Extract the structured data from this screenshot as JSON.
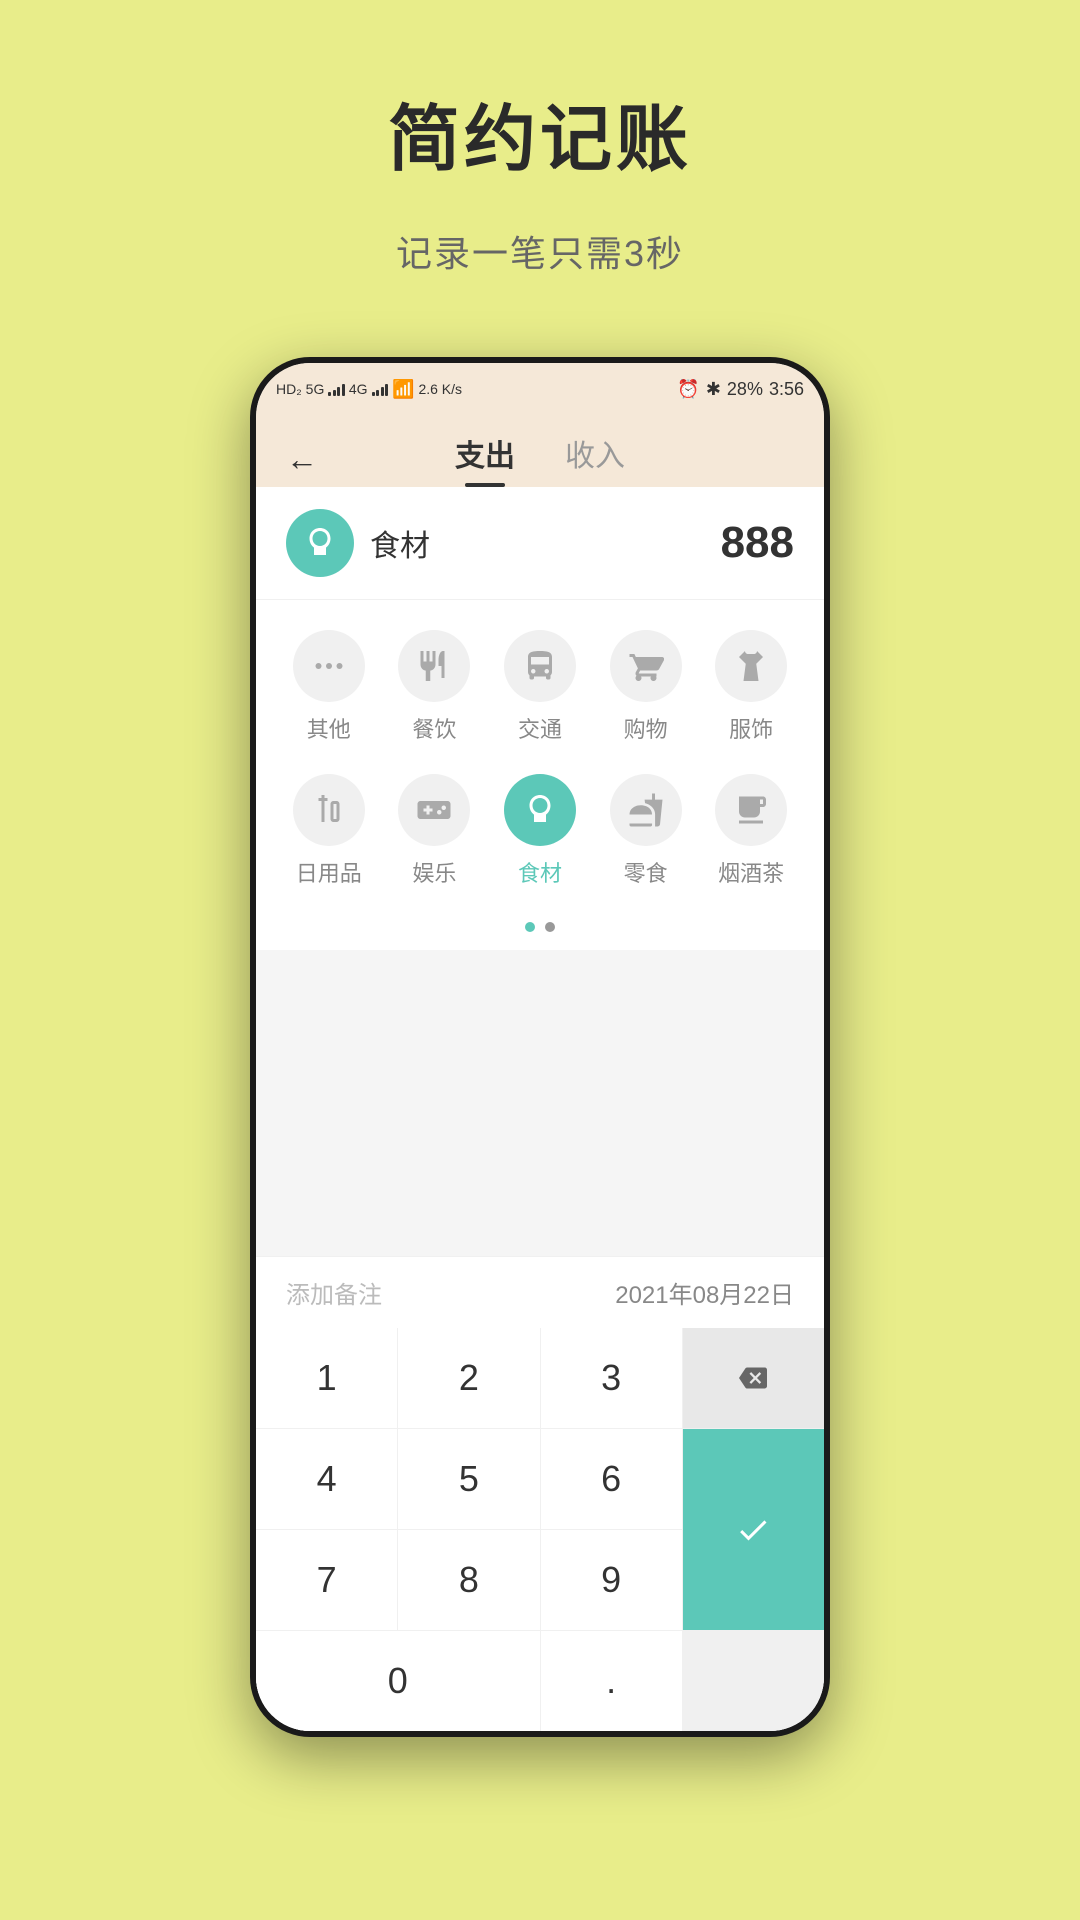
{
  "page": {
    "title": "简约记账",
    "subtitle": "记录一笔只需3秒"
  },
  "statusBar": {
    "leftText": "5G 4G",
    "speed": "2.6 K/s",
    "battery": "28%",
    "time": "3:56"
  },
  "header": {
    "backLabel": "←",
    "tabs": [
      {
        "label": "支出",
        "active": true
      },
      {
        "label": "收入",
        "active": false
      }
    ]
  },
  "selectedCategory": {
    "name": "食材",
    "amount": "888"
  },
  "categories": [
    {
      "id": "other",
      "label": "其他",
      "active": false
    },
    {
      "id": "food",
      "label": "餐饮",
      "active": false
    },
    {
      "id": "transport",
      "label": "交通",
      "active": false
    },
    {
      "id": "shopping",
      "label": "购物",
      "active": false
    },
    {
      "id": "clothing",
      "label": "服饰",
      "active": false
    },
    {
      "id": "daily",
      "label": "日用品",
      "active": false
    },
    {
      "id": "entertainment",
      "label": "娱乐",
      "active": false
    },
    {
      "id": "ingredients",
      "label": "食材",
      "active": true
    },
    {
      "id": "snacks",
      "label": "零食",
      "active": false
    },
    {
      "id": "tobacco",
      "label": "烟酒茶",
      "active": false
    }
  ],
  "pagination": {
    "total": 2,
    "current": 0
  },
  "noteArea": {
    "placeholder": "添加备注",
    "date": "2021年08月22日"
  },
  "numpad": {
    "buttons": [
      "1",
      "2",
      "3",
      "DELETE",
      "4",
      "5",
      "6",
      "CONFIRM",
      "7",
      "8",
      "9",
      "",
      "0",
      "0",
      ".",
      ""
    ]
  }
}
